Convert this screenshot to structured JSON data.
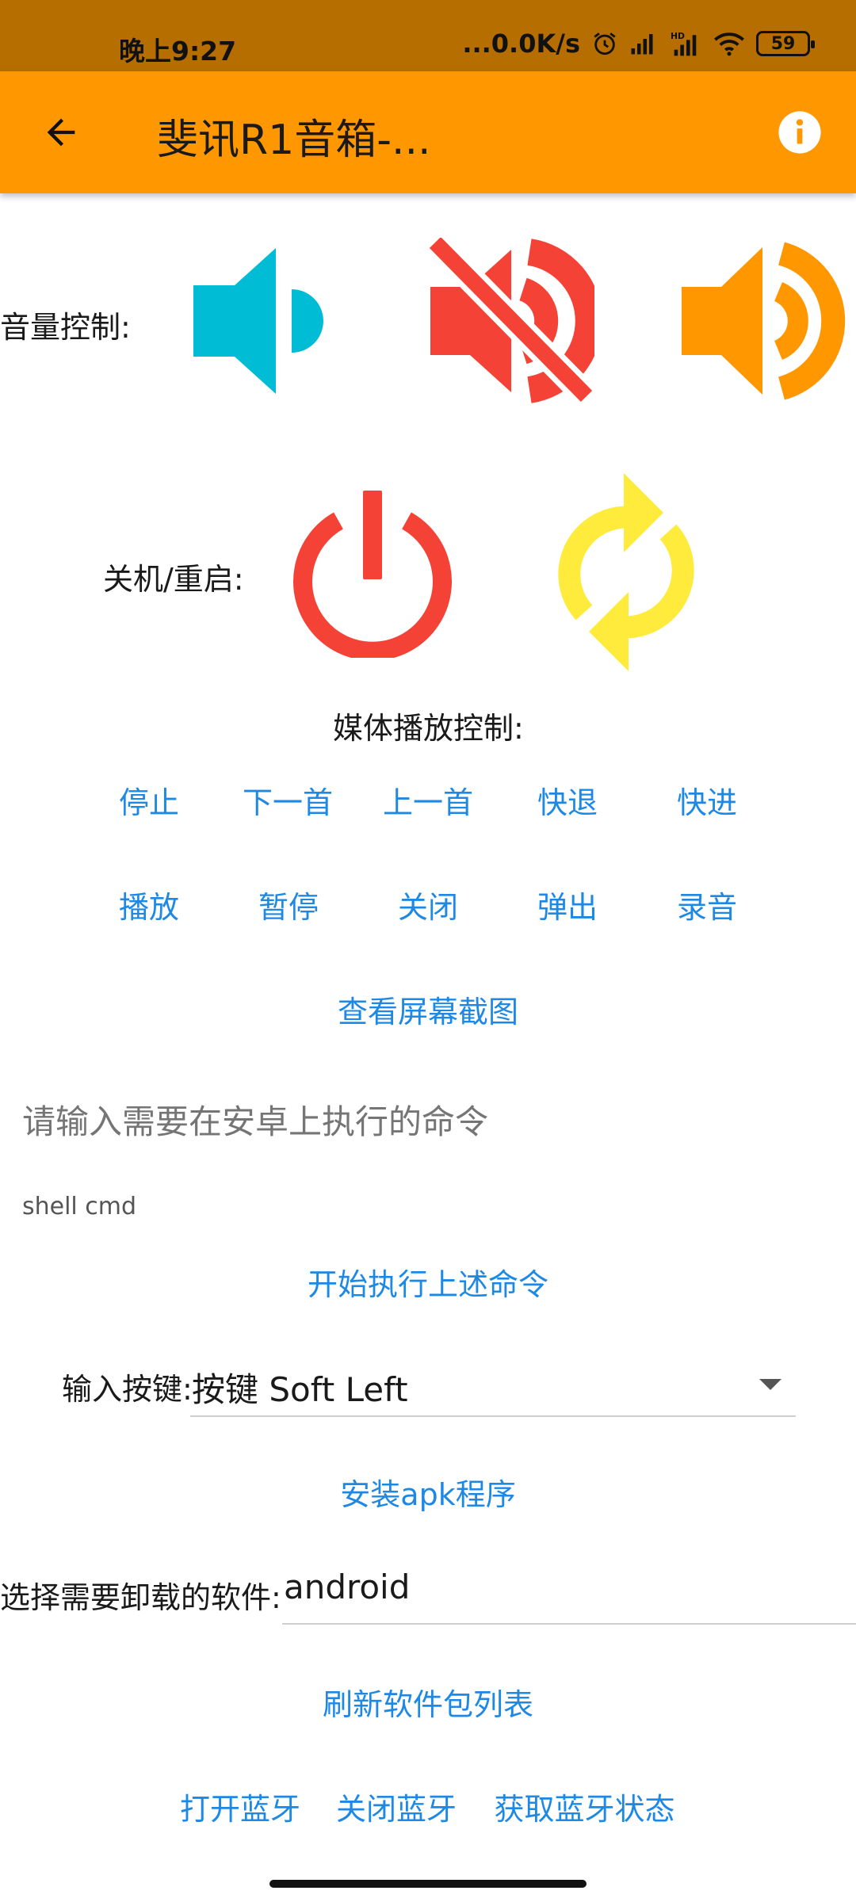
{
  "status_bar": {
    "time": "晚上9:27",
    "network_speed": "...0.0K/s",
    "battery": "59",
    "icons": [
      "alarm-icon",
      "signal-icon",
      "hd-signal-icon",
      "wifi-icon",
      "battery-icon"
    ]
  },
  "app_bar": {
    "title": "斐讯R1音箱-...",
    "back_icon": "arrow-left-icon",
    "info_icon": "info-icon",
    "color": "#FF9800"
  },
  "volume": {
    "label": "音量控制:",
    "buttons": [
      {
        "name": "volume-down-icon",
        "color": "#00BCD4"
      },
      {
        "name": "volume-mute-icon",
        "color": "#F44336"
      },
      {
        "name": "volume-up-icon",
        "color": "#FF9800"
      }
    ]
  },
  "power": {
    "label": "关机/重启:",
    "buttons": [
      {
        "name": "power-icon",
        "color": "#F44336"
      },
      {
        "name": "restart-icon",
        "color": "#FFEB3B"
      }
    ]
  },
  "media": {
    "label": "媒体播放控制:",
    "row1": [
      "停止",
      "下一首",
      "上一首",
      "快退",
      "快进"
    ],
    "row2": [
      "播放",
      "暂停",
      "关闭",
      "弹出",
      "录音"
    ],
    "screenshot": "查看屏幕截图"
  },
  "shell": {
    "placeholder": "请输入需要在安卓上执行的命令",
    "helper": "shell cmd",
    "execute": "开始执行上述命令"
  },
  "keys": {
    "label": "输入按键:",
    "selected": "按键 Soft Left"
  },
  "apk": {
    "install": "安装apk程序"
  },
  "uninstall": {
    "label": "选择需要卸载的软件:",
    "selected": "android",
    "refresh": "刷新软件包列表"
  },
  "bluetooth": {
    "on": "打开蓝牙",
    "off": "关闭蓝牙",
    "status": "获取蓝牙状态"
  },
  "link_color": "#1E88E5"
}
